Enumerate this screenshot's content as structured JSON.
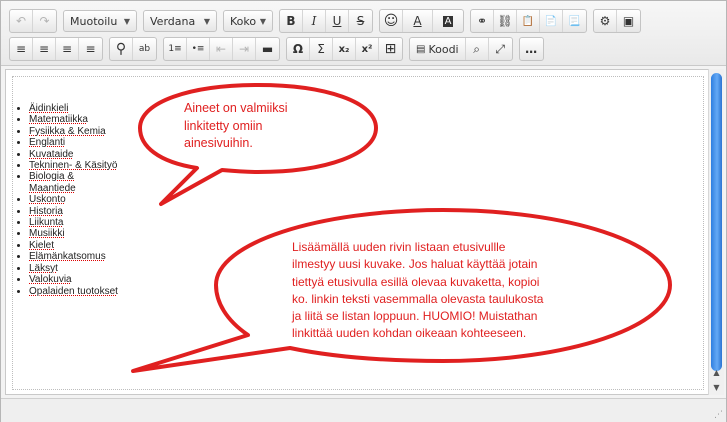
{
  "toolbar": {
    "row1": {
      "undo_icon": "↶",
      "redo_icon": "↷",
      "format_select": "Muotoilu",
      "font_select": "Verdana",
      "size_select": "Koko",
      "bold": "B",
      "italic": "I",
      "underline": "U",
      "strike": "S",
      "emoji_icon": "☺",
      "text_color_icon": "A",
      "bg_color_icon": "A",
      "link_icon": "⚭",
      "unlink_icon": "⛓",
      "paste_icon": "📋",
      "paste_text_icon": "📄",
      "paste_word_icon": "📃",
      "flash_icon": "⚙",
      "image_icon": "▣"
    },
    "row2": {
      "align_left": "≡",
      "align_center": "≡",
      "align_right": "≡",
      "align_justify": "≡",
      "search_icon": "⚲",
      "replace_icon": "ab",
      "ordered_list": "1≡",
      "bullet_list": "•≡",
      "outdent": "⇤",
      "indent": "⇥",
      "hr": "▬",
      "omega": "Ω",
      "sigma": "Σ",
      "subscript": "x₂",
      "superscript": "x²",
      "table_icon": "⊞",
      "source_label": "Koodi",
      "preview_icon": "⌕",
      "fullscreen_icon": "⤢",
      "more_icon": "…"
    }
  },
  "content": {
    "list_items": [
      "Äidinkieli",
      "Matematiikka",
      "Fysiikka & Kemia",
      "Englanti",
      "Kuvataide",
      "Tekninen- & Käsityö",
      "Biologia & Maantiede",
      "Uskonto",
      "Historia",
      "Liikunta",
      "Musiikki",
      "Kielet",
      "Elämänkatsomus",
      "Läksyt",
      "Valokuvia",
      "Opalaiden tuotokset"
    ]
  },
  "annotations": {
    "bubble1_lines": [
      "Aineet on valmiiksi",
      "linkitetty omiin",
      "ainesivuihin."
    ],
    "bubble2_lines": [
      "Lisäämällä uuden rivin listaan etusivullle",
      "ilmestyy uusi kuvake. Jos haluat käyttää jotain",
      "tiettyä etusivulla esillä olevaa kuvaketta, kopioi",
      "ko. linkin teksti vasemmalla olevasta taulukosta",
      "ja liitä se listan loppuun. HUOMIO! Muistathan",
      "linkittää uuden kohdan oikeaan kohteeseen."
    ],
    "color": "#e02020"
  },
  "scrollbar": {
    "up": "▲",
    "down": "▼"
  }
}
